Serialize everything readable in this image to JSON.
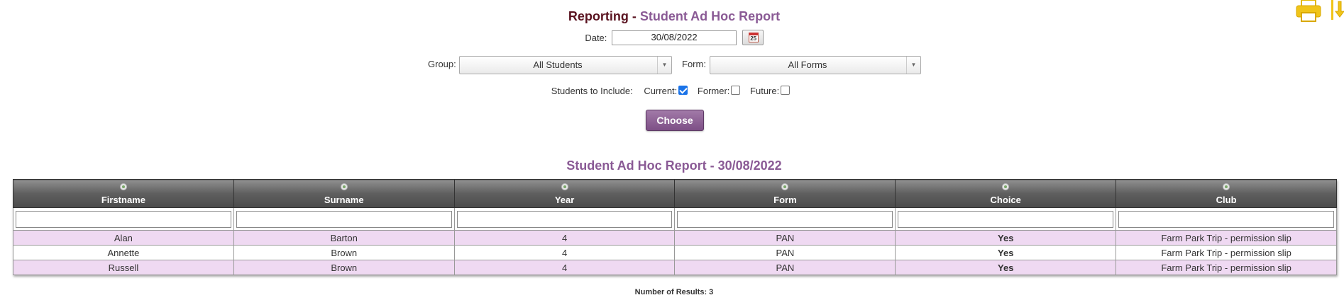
{
  "header": {
    "title_prefix": "Reporting - ",
    "title_suffix": "Student Ad Hoc Report"
  },
  "filters": {
    "date_label": "Date:",
    "date_value": "30/08/2022",
    "calendar_icon": "calendar-icon",
    "calendar_day": "25",
    "group_label": "Group:",
    "group_value": "All Students",
    "form_label": "Form:",
    "form_value": "All Forms",
    "include_label": "Students to Include:",
    "current_label": "Current:",
    "current_checked": true,
    "former_label": "Former:",
    "former_checked": false,
    "future_label": "Future:",
    "future_checked": false,
    "choose_label": "Choose"
  },
  "report": {
    "title": "Student Ad Hoc Report - 30/08/2022",
    "columns": [
      "Firstname",
      "Surname",
      "Year",
      "Form",
      "Choice",
      "Club"
    ],
    "rows": [
      [
        "Alan",
        "Barton",
        "4",
        "PAN",
        "Yes",
        "Farm Park Trip - permission slip"
      ],
      [
        "Annette",
        "Brown",
        "4",
        "PAN",
        "Yes",
        "Farm Park Trip - permission slip"
      ],
      [
        "Russell",
        "Brown",
        "4",
        "PAN",
        "Yes",
        "Farm Park Trip - permission slip"
      ]
    ],
    "results_text": "Number of Results: 3"
  },
  "toolbar": {
    "print_icon": "printer-icon",
    "download_icon": "download-icon"
  },
  "colors": {
    "title_dark": "#5a1320",
    "accent_purple": "#8a5a95",
    "row_highlight": "#efd9f2",
    "button_purple": "#7d4f86",
    "icon_yellow": "#f0c419"
  }
}
